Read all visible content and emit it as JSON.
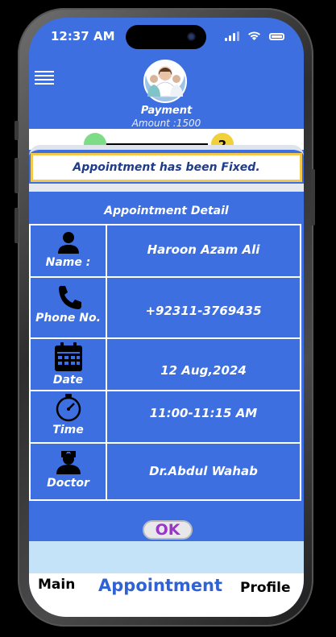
{
  "status": {
    "time": "12:37 AM"
  },
  "header": {
    "title": "Payment",
    "amount": "Amount :1500"
  },
  "stepper": {
    "step2": "2"
  },
  "dialog": {
    "banner": "Appointment  has been Fixed.",
    "title": "Appointment Detail",
    "rows": [
      {
        "icon": "person-icon",
        "label": "Name :",
        "value": "Haroon Azam Ali"
      },
      {
        "icon": "phone-icon",
        "label": "Phone No.",
        "value": "+92311-3769435"
      },
      {
        "icon": "calendar-icon",
        "label": "Date",
        "value": "12 Aug,2024"
      },
      {
        "icon": "stopwatch-icon",
        "label": "Time",
        "value": "11:00-11:15 AM"
      },
      {
        "icon": "doctor-icon",
        "label": "Doctor",
        "value": "Dr.Abdul Wahab"
      }
    ],
    "ok": "OK"
  },
  "tabs": {
    "main": "Main",
    "appointment": "Appointment",
    "profile": "Profile"
  },
  "colors": {
    "primary": "#3d6fe0",
    "banner_text": "#1e3c8a",
    "ok_text": "#9a35c9",
    "active_tab": "#2e62d6"
  }
}
